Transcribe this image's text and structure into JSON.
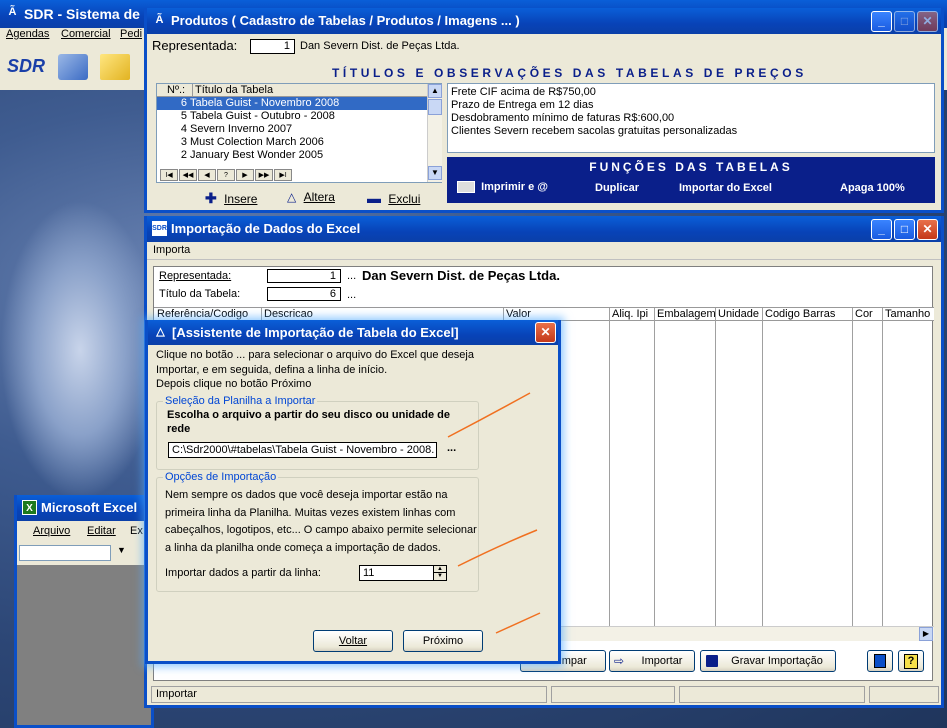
{
  "desktop": {
    "main_title": "SDR - Sistema de Re",
    "menus": [
      "Agendas",
      "Comercial",
      "Pedi"
    ],
    "logo": "SDR"
  },
  "excel": {
    "title": "Microsoft Excel",
    "menus": [
      "Arquivo",
      "Editar",
      "Ex"
    ]
  },
  "produtos": {
    "title": "Produtos ( Cadastro de Tabelas / Produtos / Imagens ... )",
    "representada_label": "Representada:",
    "representada_num": "1",
    "representada_name": "Dan Severn Dist. de Peças Ltda.",
    "banner": "TÍTULOS E OBSERVAÇÕES DAS TABELAS DE PREÇOS",
    "table_headers": [
      "Nº.:",
      "Título da Tabela"
    ],
    "rows": [
      {
        "n": "6",
        "t": "Tabela Guist - Novembro 2008",
        "selected": true
      },
      {
        "n": "5",
        "t": "Tabela Guist - Outubro - 2008"
      },
      {
        "n": "4",
        "t": "Severn Inverno 2007"
      },
      {
        "n": "3",
        "t": "Must Colection March 2006"
      },
      {
        "n": "2",
        "t": "January Best Wonder 2005"
      }
    ],
    "nav": [
      "I◀",
      "◀◀",
      "◀",
      "?",
      "▶",
      "▶▶",
      "▶I"
    ],
    "obs": [
      "Frete CIF acima de R$750,00",
      "Prazo de Entrega em 12 dias",
      "Desdobramento mínimo de faturas R$:600,00",
      "Clientes Severn recebem sacolas gratuitas personalizadas"
    ],
    "insere": "Insere",
    "altera": "Altera",
    "exclui": "Exclui",
    "funcoes_title": "FUNÇÕES DAS TABELAS",
    "imprimir": "Imprimir e @",
    "duplicar": "Duplicar",
    "importar_excel": "Importar do Excel",
    "apaga": "Apaga 100%"
  },
  "importacao": {
    "title": "Importação de Dados do Excel",
    "menu": "Importa",
    "representada_label": "Representada:",
    "representada_num": "1",
    "representada_name": "Dan Severn Dist. de Peças Ltda.",
    "titulo_label": "Título da Tabela:",
    "titulo_num": "6",
    "ellipsis": "...",
    "columns": [
      "Referência/Codigo",
      "Descricao",
      "Valor",
      "Aliq. Ipi",
      "Embalagem",
      "Unidade",
      "Codigo Barras",
      "Cor",
      "Tamanho"
    ],
    "limpar": "Limpar",
    "importar": "Importar",
    "gravar": "Gravar Importação",
    "status": "Importar"
  },
  "wizard": {
    "title": "[Assistente de Importação de Tabela do Excel]",
    "intro1": "Clique no botão ... para selecionar o arquivo do Excel que deseja",
    "intro2": "Importar, e em seguida, defina a linha de início.",
    "intro3": "Depois clique no botão Próximo",
    "group1": "Seleção da Planilha a Importar",
    "choose": "Escolha o arquivo a partir do seu disco ou unidade de rede",
    "file_path": "C:\\Sdr2000\\#tabelas\\Tabela Guist - Novembro - 2008.",
    "browse": "...",
    "group2": "Opções de Importação",
    "desc1": "Nem sempre os dados que você deseja importar estão na",
    "desc2": "primeira linha da Planilha. Muitas vezes existem linhas com",
    "desc3": "cabeçalhos, logotipos, etc... O campo abaixo permite selecionar",
    "desc4": "a linha da planilha onde  começa a importação de dados.",
    "start_label": "Importar dados a partir da linha:",
    "start_value": "11",
    "voltar": "Voltar",
    "proximo": "Próximo"
  },
  "colors": {
    "title_blue": "#0a4fc8",
    "navy_panel": "#0a1f8a",
    "banner_text": "#0a1f8a",
    "annotation": "#f07020"
  }
}
